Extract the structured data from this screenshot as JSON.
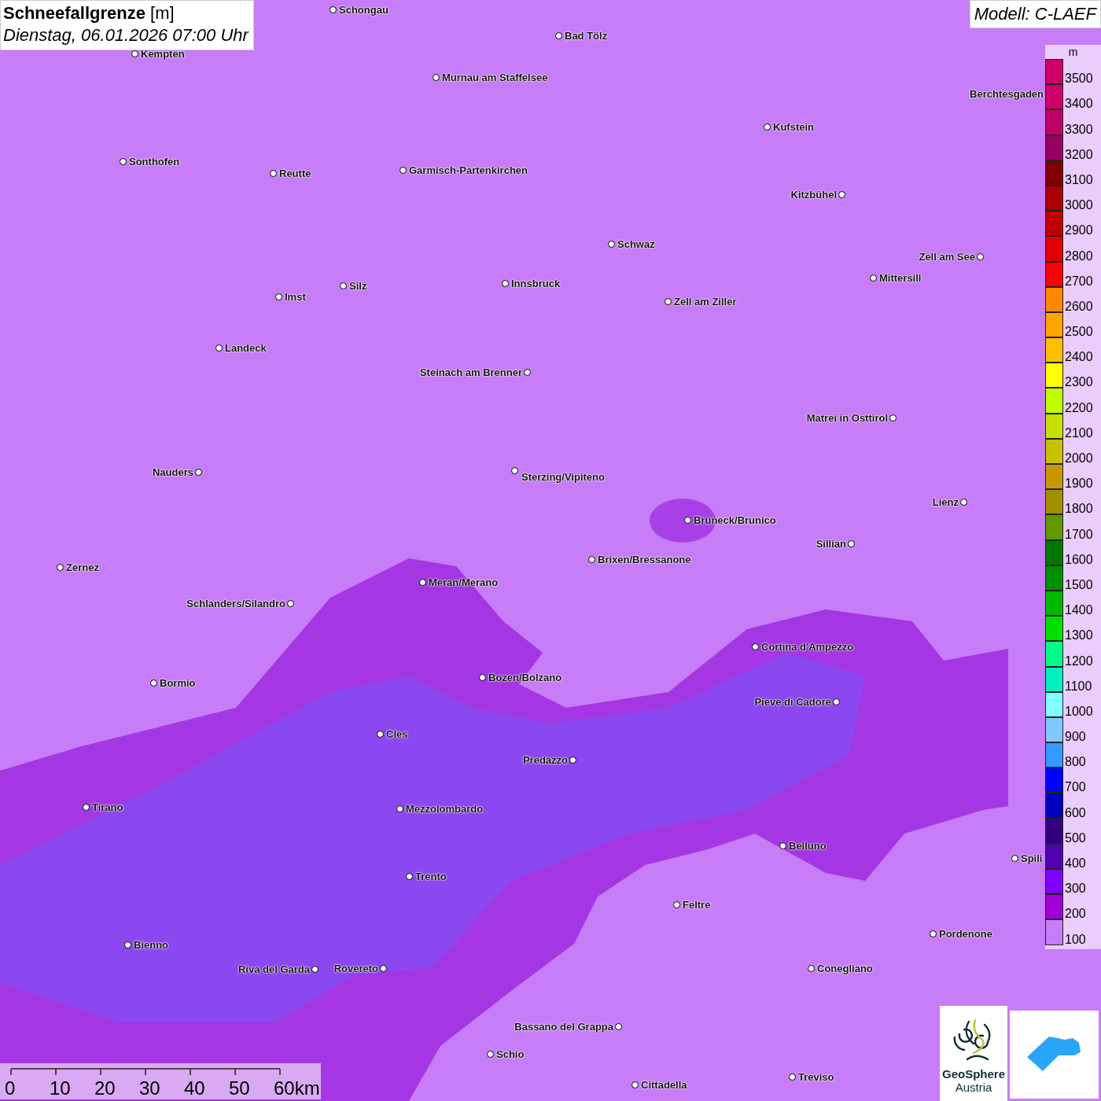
{
  "title": {
    "parameter": "Schneefallgrenze",
    "unit": "[m]",
    "datetime": "Dienstag, 06.01.2026 07:00 Uhr"
  },
  "model": "Modell: C-LAEF",
  "cities": [
    {
      "name": "Schongau"
    },
    {
      "name": "Bad Tölz"
    },
    {
      "name": "Kempten"
    },
    {
      "name": "Murnau am Staffelsee"
    },
    {
      "name": "Berchtesgaden"
    },
    {
      "name": "Kufstein"
    },
    {
      "name": "Sonthofen"
    },
    {
      "name": "Reutte"
    },
    {
      "name": "Garmisch-Partenkirchen"
    },
    {
      "name": "Kitzbühel"
    },
    {
      "name": "Schwaz"
    },
    {
      "name": "Zell am See"
    },
    {
      "name": "Mittersill"
    },
    {
      "name": "Innsbruck"
    },
    {
      "name": "Zell am Ziller"
    },
    {
      "name": "Silz"
    },
    {
      "name": "Imst"
    },
    {
      "name": "Landeck"
    },
    {
      "name": "Steinach am Brenner"
    },
    {
      "name": "Matrei in Osttirol"
    },
    {
      "name": "Nauders"
    },
    {
      "name": "Sterzing/Vipiteno"
    },
    {
      "name": "Lienz"
    },
    {
      "name": "Bruneck/Brunico"
    },
    {
      "name": "Sillian"
    },
    {
      "name": "Zernez"
    },
    {
      "name": "Brixen/Bressanone"
    },
    {
      "name": "Meran/Merano"
    },
    {
      "name": "Schlanders/Silandro"
    },
    {
      "name": "Cortina d'Ampezzo"
    },
    {
      "name": "Bormio"
    },
    {
      "name": "Bozen/Bolzano"
    },
    {
      "name": "Pieve di Cadore"
    },
    {
      "name": "Cles"
    },
    {
      "name": "Predazzo"
    },
    {
      "name": "Tirano"
    },
    {
      "name": "Mezzolombardo"
    },
    {
      "name": "Belluno"
    },
    {
      "name": "Spili"
    },
    {
      "name": "Trento"
    },
    {
      "name": "Feltre"
    },
    {
      "name": "Pordenone"
    },
    {
      "name": "Bienno"
    },
    {
      "name": "Riva del Garda"
    },
    {
      "name": "Rovereto"
    },
    {
      "name": "Conegliano"
    },
    {
      "name": "Bassano del Grappa"
    },
    {
      "name": "Schio"
    },
    {
      "name": "Treviso"
    },
    {
      "name": "Cittadella"
    }
  ],
  "legend": {
    "unit": "m",
    "steps": [
      {
        "label": "3500",
        "color": "#cc0066"
      },
      {
        "label": "3400",
        "color": "#cc0066"
      },
      {
        "label": "3300",
        "color": "#c00068"
      },
      {
        "label": "3200",
        "color": "#990066"
      },
      {
        "label": "3100",
        "color": "#800000"
      },
      {
        "label": "3000",
        "color": "#aa0000"
      },
      {
        "label": "2900",
        "color": "#c00000"
      },
      {
        "label": "2800",
        "color": "#e00000"
      },
      {
        "label": "2700",
        "color": "#ff0000"
      },
      {
        "label": "2600",
        "color": "#ff8800"
      },
      {
        "label": "2500",
        "color": "#ffa500"
      },
      {
        "label": "2400",
        "color": "#ffbf00"
      },
      {
        "label": "2300",
        "color": "#ffff00"
      },
      {
        "label": "2200",
        "color": "#c0ff00"
      },
      {
        "label": "2100",
        "color": "#c8e000"
      },
      {
        "label": "2000",
        "color": "#c8c000"
      },
      {
        "label": "1900",
        "color": "#c89800"
      },
      {
        "label": "1800",
        "color": "#a09000"
      },
      {
        "label": "1700",
        "color": "#609800"
      },
      {
        "label": "1600",
        "color": "#007800"
      },
      {
        "label": "1500",
        "color": "#009000"
      },
      {
        "label": "1400",
        "color": "#00b800"
      },
      {
        "label": "1300",
        "color": "#00e000"
      },
      {
        "label": "1200",
        "color": "#00ff88"
      },
      {
        "label": "1100",
        "color": "#00f0c0"
      },
      {
        "label": "1000",
        "color": "#80ffff"
      },
      {
        "label": "900",
        "color": "#80c8ff"
      },
      {
        "label": "800",
        "color": "#3399ff"
      },
      {
        "label": "700",
        "color": "#0000ff"
      },
      {
        "label": "600",
        "color": "#0000c0"
      },
      {
        "label": "500",
        "color": "#330080"
      },
      {
        "label": "400",
        "color": "#5000b0"
      },
      {
        "label": "300",
        "color": "#8000ff"
      },
      {
        "label": "200",
        "color": "#a000d8"
      },
      {
        "label": "100",
        "color": "#c77cf8"
      }
    ]
  },
  "scale_bar": {
    "labels": [
      "0",
      "10",
      "20",
      "30",
      "40",
      "50",
      "60km"
    ]
  },
  "logo": {
    "line_1": "GeoSphere",
    "line_2": "Austria"
  }
}
